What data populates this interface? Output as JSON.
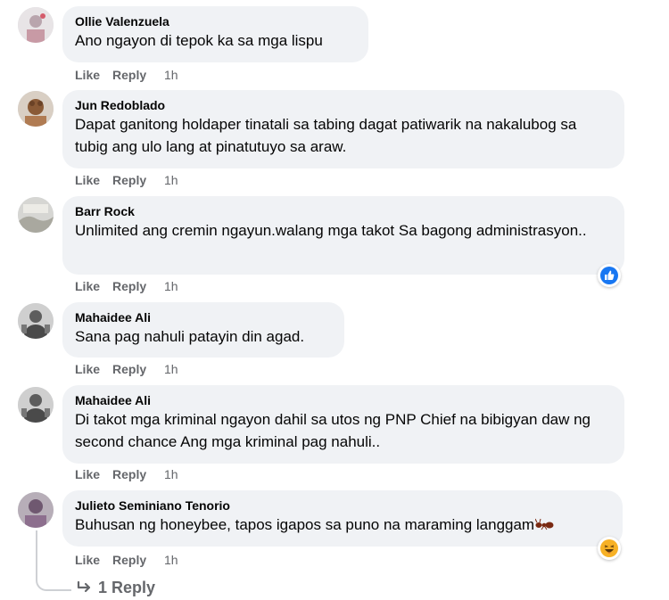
{
  "comments": [
    {
      "author": "Ollie Valenzuela",
      "text": "Ano ngayon di tepok ka sa mga lispu",
      "like": "Like",
      "reply": "Reply",
      "time": "1h"
    },
    {
      "author": "Jun Redoblado",
      "text": "Dapat ganitong holdaper tinatali sa tabing dagat patiwarik na nakalubog sa tubig ang ulo lang at pinatutuyo sa araw.",
      "like": "Like",
      "reply": "Reply",
      "time": "1h"
    },
    {
      "author": "Barr Rock",
      "text": "Unlimited ang cremin ngayun.walang mga takot Sa bagong administrasyon..",
      "like": "Like",
      "reply": "Reply",
      "time": "1h",
      "reaction": "like-reaction-icon"
    },
    {
      "author": "Mahaidee Ali",
      "text": "Sana pag nahuli patayin din agad.",
      "like": "Like",
      "reply": "Reply",
      "time": "1h"
    },
    {
      "author": "Mahaidee Ali",
      "text": "Di takot mga kriminal ngayon dahil sa utos ng PNP Chief na bibigyan daw ng second chance Ang mga kriminal pag nahuli..",
      "like": "Like",
      "reply": "Reply",
      "time": "1h"
    },
    {
      "author": "Julieto Seminiano Tenorio",
      "text": "Buhusan ng honeybee, tapos igapos sa puno na maraming langgam",
      "like": "Like",
      "reply": "Reply",
      "time": "1h",
      "emoji": "ant-emoji",
      "reaction": "haha-reaction-icon"
    }
  ],
  "replies_link": "1 Reply",
  "colors": {
    "bubble": "#f0f2f5",
    "secondary_text": "#65676b",
    "like_blue": "#1877f2",
    "haha_yellow": "#f7b125"
  }
}
